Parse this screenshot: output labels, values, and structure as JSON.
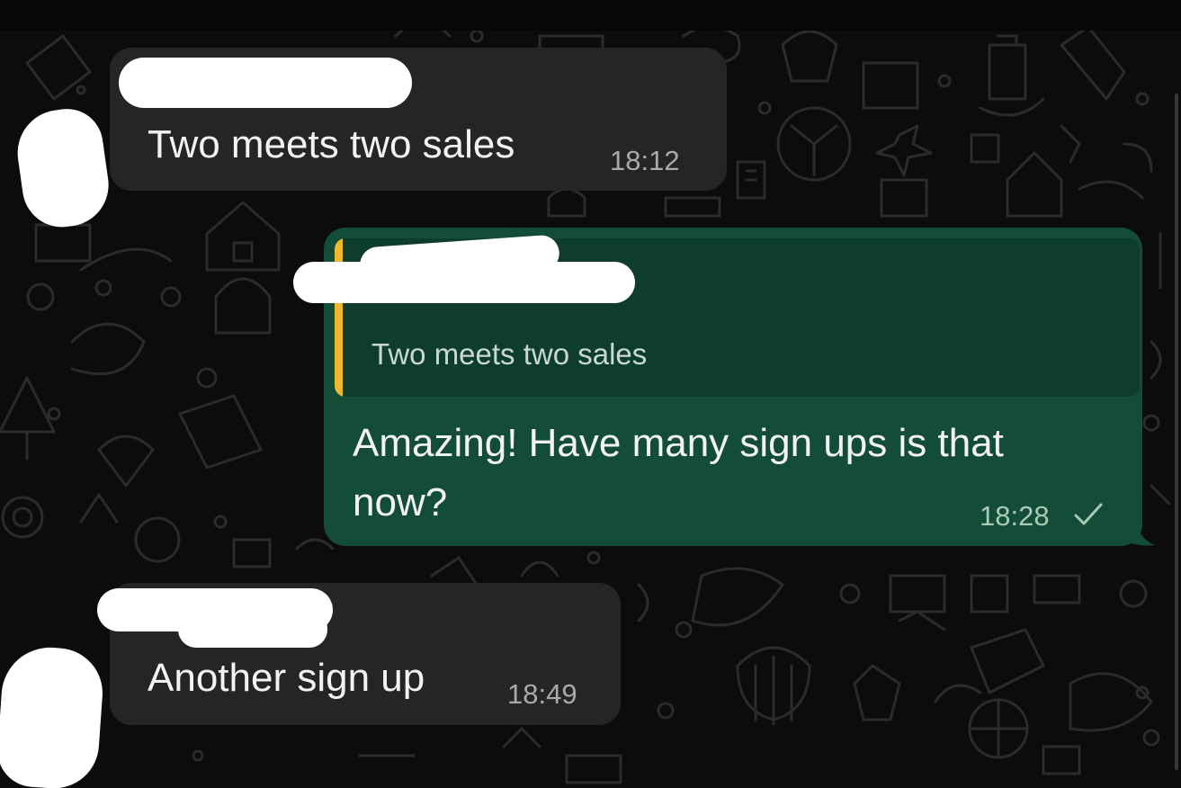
{
  "messages": [
    {
      "direction": "incoming",
      "sender_hidden": true,
      "text": "Two meets two sales",
      "time": "18:12"
    },
    {
      "direction": "outgoing",
      "reply_to": {
        "sender_hidden": true,
        "text": "Two meets two sales"
      },
      "text_line1": "Amazing! Have many sign ups is that",
      "text_line2": "now?",
      "time": "18:28",
      "status_icon": "single-check-icon"
    },
    {
      "direction": "incoming",
      "sender_hidden": true,
      "text": "Another sign up",
      "time": "18:49"
    }
  ],
  "colors": {
    "background": "#0c0c0c",
    "incoming_bubble": "#242626",
    "outgoing_bubble": "#144d37",
    "quote_background": "#0f3d2c",
    "quote_accent": "#f0b82e",
    "text": "#f2f2f2",
    "timestamp": "#a8aaab"
  }
}
